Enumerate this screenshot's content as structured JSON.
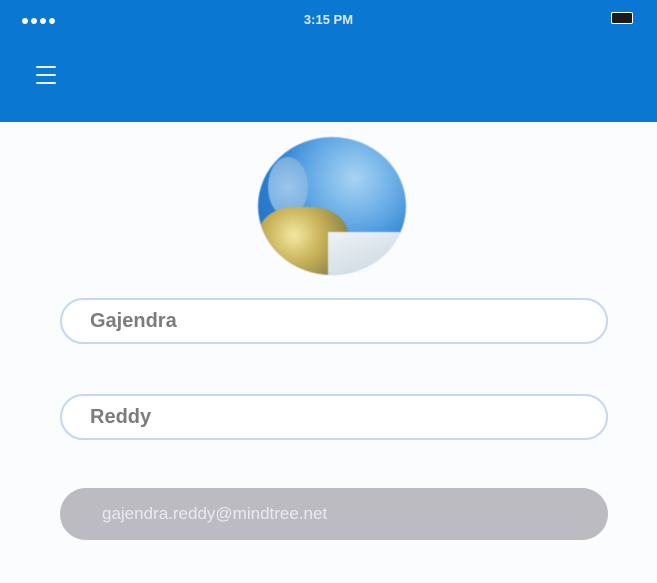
{
  "status_bar": {
    "signal_dots": 4,
    "carrier": "",
    "time": "3:15 PM",
    "battery_text": "",
    "battery_level": 0.9
  },
  "header": {
    "menu_icon": "hamburger-menu-icon",
    "background_color": "#0a78d2"
  },
  "profile": {
    "avatar_icon": "profile-photo",
    "first_name": "Gajendra",
    "last_name": "Reddy",
    "email": "gajendra.reddy@mindtree.net",
    "hint": ""
  },
  "colors": {
    "field_border": "#c8d6f2",
    "disabled_field": "#bbbbc1"
  }
}
